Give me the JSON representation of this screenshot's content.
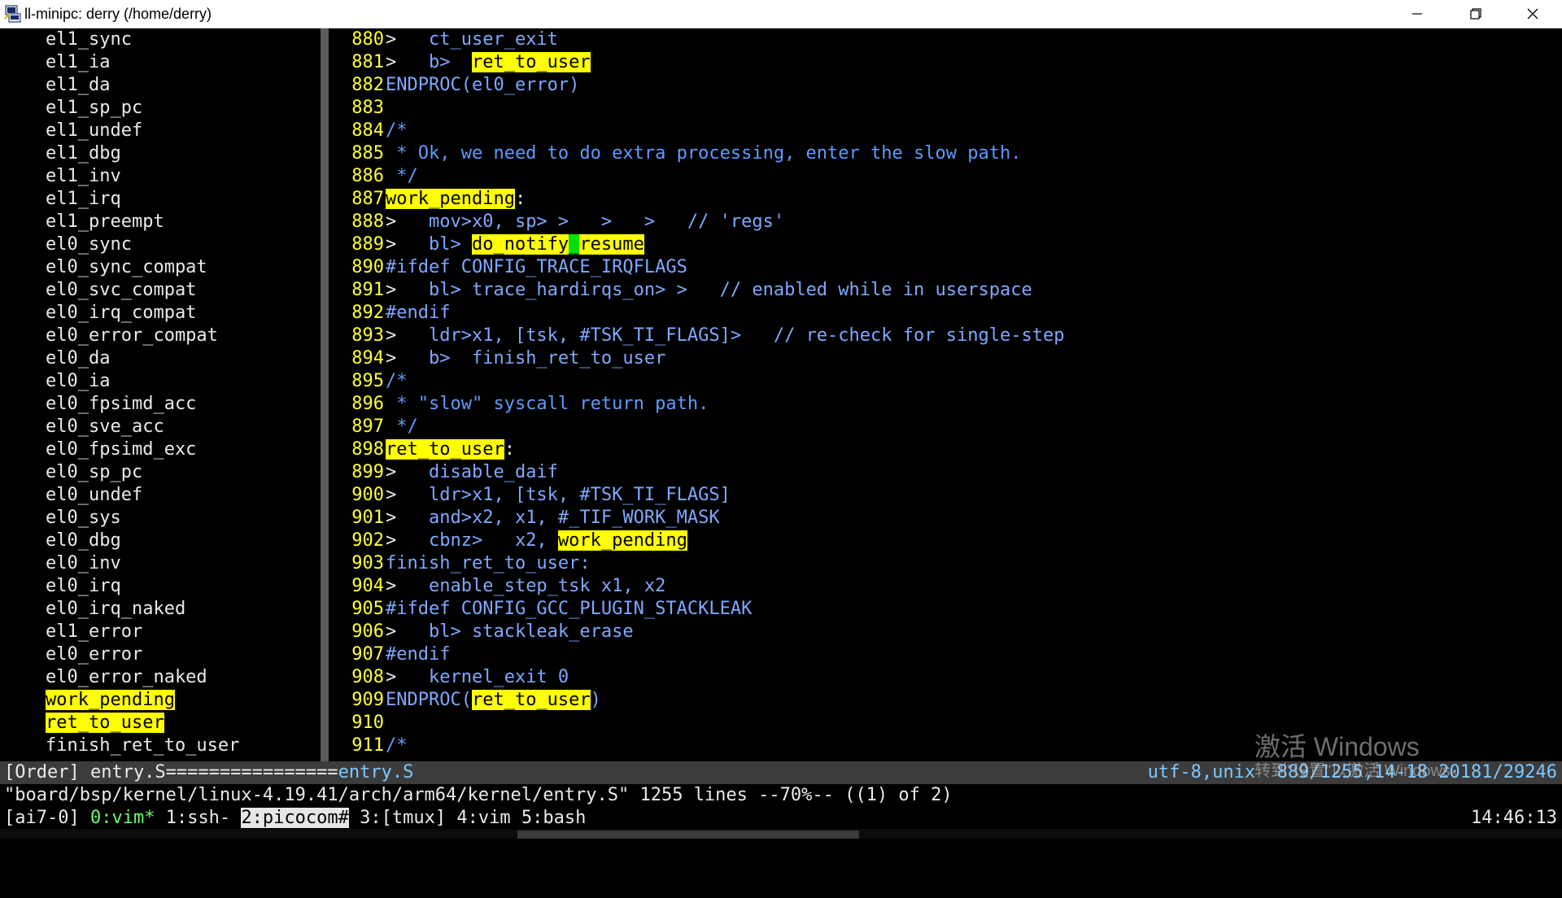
{
  "window": {
    "title": "ll-minipc: derry (/home/derry)",
    "icon": "putty-terminal-icon",
    "controls": [
      "minimize-icon",
      "restore-icon",
      "close-icon"
    ]
  },
  "sidebar": {
    "items": [
      {
        "label": "el1_sync",
        "highlight": false
      },
      {
        "label": "el1_ia",
        "highlight": false
      },
      {
        "label": "el1_da",
        "highlight": false
      },
      {
        "label": "el1_sp_pc",
        "highlight": false
      },
      {
        "label": "el1_undef",
        "highlight": false
      },
      {
        "label": "el1_dbg",
        "highlight": false
      },
      {
        "label": "el1_inv",
        "highlight": false
      },
      {
        "label": "el1_irq",
        "highlight": false
      },
      {
        "label": "el1_preempt",
        "highlight": false
      },
      {
        "label": "el0_sync",
        "highlight": false
      },
      {
        "label": "el0_sync_compat",
        "highlight": false
      },
      {
        "label": "el0_svc_compat",
        "highlight": false
      },
      {
        "label": "el0_irq_compat",
        "highlight": false
      },
      {
        "label": "el0_error_compat",
        "highlight": false
      },
      {
        "label": "el0_da",
        "highlight": false
      },
      {
        "label": "el0_ia",
        "highlight": false
      },
      {
        "label": "el0_fpsimd_acc",
        "highlight": false
      },
      {
        "label": "el0_sve_acc",
        "highlight": false
      },
      {
        "label": "el0_fpsimd_exc",
        "highlight": false
      },
      {
        "label": "el0_sp_pc",
        "highlight": false
      },
      {
        "label": "el0_undef",
        "highlight": false
      },
      {
        "label": "el0_sys",
        "highlight": false
      },
      {
        "label": "el0_dbg",
        "highlight": false
      },
      {
        "label": "el0_inv",
        "highlight": false
      },
      {
        "label": "el0_irq",
        "highlight": false
      },
      {
        "label": "el0_irq_naked",
        "highlight": false
      },
      {
        "label": "el1_error",
        "highlight": false
      },
      {
        "label": "el0_error",
        "highlight": false
      },
      {
        "label": "el0_error_naked",
        "highlight": false
      },
      {
        "label": "work_pending",
        "highlight": true
      },
      {
        "label": "ret_to_user",
        "highlight": true
      },
      {
        "label": "finish_ret_to_user",
        "highlight": false
      }
    ]
  },
  "code": {
    "lines": [
      {
        "num": "880",
        "segments": [
          {
            "t": ">",
            "c": "sp"
          },
          {
            "t": "   ct_user_exit"
          }
        ]
      },
      {
        "num": "881",
        "segments": [
          {
            "t": ">",
            "c": "sp"
          },
          {
            "t": "   b>  "
          },
          {
            "t": "ret_to_user",
            "c": "hl"
          }
        ]
      },
      {
        "num": "882",
        "segments": [
          {
            "t": "ENDPROC(el0_error)"
          }
        ]
      },
      {
        "num": "883",
        "segments": []
      },
      {
        "num": "884",
        "segments": [
          {
            "t": "/*",
            "c": "cm"
          }
        ]
      },
      {
        "num": "885",
        "segments": [
          {
            "t": " * Ok, we need to do extra processing, enter the slow path.",
            "c": "cm"
          }
        ]
      },
      {
        "num": "886",
        "segments": [
          {
            "t": " */",
            "c": "cm"
          }
        ]
      },
      {
        "num": "887",
        "segments": [
          {
            "t": "work_pending",
            "c": "hl"
          },
          {
            "t": ":",
            "c": "sp"
          }
        ]
      },
      {
        "num": "888",
        "segments": [
          {
            "t": ">",
            "c": "sp"
          },
          {
            "t": "   mov>x0, sp> >   >   >   // 'regs'"
          }
        ]
      },
      {
        "num": "889",
        "segments": [
          {
            "t": ">",
            "c": "sp"
          },
          {
            "t": "   bl> "
          },
          {
            "t": "do_notify",
            "c": "hl"
          },
          {
            "t": "_",
            "c": "gc"
          },
          {
            "t": "resume",
            "c": "hl"
          }
        ]
      },
      {
        "num": "890",
        "segments": [
          {
            "t": "#ifdef CONFIG_TRACE_IRQFLAGS"
          }
        ]
      },
      {
        "num": "891",
        "segments": [
          {
            "t": ">",
            "c": "sp"
          },
          {
            "t": "   bl> trace_hardirqs_on> >   // enabled while in userspace"
          }
        ]
      },
      {
        "num": "892",
        "segments": [
          {
            "t": "#endif"
          }
        ]
      },
      {
        "num": "893",
        "segments": [
          {
            "t": ">",
            "c": "sp"
          },
          {
            "t": "   ldr>x1, [tsk, #TSK_TI_FLAGS]>   // re-check for single-step"
          }
        ]
      },
      {
        "num": "894",
        "segments": [
          {
            "t": ">",
            "c": "sp"
          },
          {
            "t": "   b>  finish_ret_to_user"
          }
        ]
      },
      {
        "num": "895",
        "segments": [
          {
            "t": "/*",
            "c": "cm"
          }
        ]
      },
      {
        "num": "896",
        "segments": [
          {
            "t": " * \"slow\" syscall return path.",
            "c": "cm"
          }
        ]
      },
      {
        "num": "897",
        "segments": [
          {
            "t": " */",
            "c": "cm"
          }
        ]
      },
      {
        "num": "898",
        "segments": [
          {
            "t": "ret_to_user",
            "c": "hl"
          },
          {
            "t": ":",
            "c": "sp"
          }
        ]
      },
      {
        "num": "899",
        "segments": [
          {
            "t": ">",
            "c": "sp"
          },
          {
            "t": "   disable_daif"
          }
        ]
      },
      {
        "num": "900",
        "segments": [
          {
            "t": ">",
            "c": "sp"
          },
          {
            "t": "   ldr>x1, [tsk, #TSK_TI_FLAGS]"
          }
        ]
      },
      {
        "num": "901",
        "segments": [
          {
            "t": ">",
            "c": "sp"
          },
          {
            "t": "   and>x2, x1, #_TIF_WORK_MASK"
          }
        ]
      },
      {
        "num": "902",
        "segments": [
          {
            "t": ">",
            "c": "sp"
          },
          {
            "t": "   cbnz>   x2, "
          },
          {
            "t": "work_pending",
            "c": "hl"
          }
        ]
      },
      {
        "num": "903",
        "segments": [
          {
            "t": "finish_ret_to_user:"
          }
        ]
      },
      {
        "num": "904",
        "segments": [
          {
            "t": ">",
            "c": "sp"
          },
          {
            "t": "   enable_step_tsk x1, x2"
          }
        ]
      },
      {
        "num": "905",
        "segments": [
          {
            "t": "#ifdef CONFIG_GCC_PLUGIN_STACKLEAK"
          }
        ]
      },
      {
        "num": "906",
        "segments": [
          {
            "t": ">",
            "c": "sp"
          },
          {
            "t": "   bl> stackleak_erase"
          }
        ]
      },
      {
        "num": "907",
        "segments": [
          {
            "t": "#endif"
          }
        ]
      },
      {
        "num": "908",
        "segments": [
          {
            "t": ">",
            "c": "sp"
          },
          {
            "t": "   kernel_exit 0"
          }
        ]
      },
      {
        "num": "909",
        "segments": [
          {
            "t": "ENDPROC("
          },
          {
            "t": "ret_to_user",
            "c": "hl"
          },
          {
            "t": ")"
          }
        ]
      },
      {
        "num": "910",
        "segments": []
      },
      {
        "num": "911",
        "segments": [
          {
            "t": "/*",
            "c": "cm"
          }
        ]
      }
    ]
  },
  "statusline": {
    "left_prefix": "[Order] entry.S================",
    "left_file": "entry.S",
    "right": "utf-8,unix  889/1255,14-18 20181/29246"
  },
  "message": "\"board/bsp/kernel/linux-4.19.41/arch/arm64/kernel/entry.S\" 1255 lines --70%-- ((1) of 2)",
  "tmux": {
    "windows": [
      {
        "label": "[ai7-0]",
        "state": "normal"
      },
      {
        "label": "0:vim*",
        "state": "active"
      },
      {
        "label": "1:ssh-",
        "state": "normal"
      },
      {
        "label": "2:picocom#",
        "state": "selected"
      },
      {
        "label": "3:[tmux]",
        "state": "normal"
      },
      {
        "label": "4:vim",
        "state": "normal"
      },
      {
        "label": "5:bash",
        "state": "normal"
      }
    ],
    "clock": "14:46:13"
  },
  "watermark": {
    "title": "激活 Windows",
    "subtitle": "转到\"设置\"以激活 Windows。"
  },
  "colors": {
    "highlight": "#ffff00",
    "line_number": "#ffff3a",
    "code_text": "#7fa8ff",
    "statusline_bg": "#3c3c3c"
  }
}
